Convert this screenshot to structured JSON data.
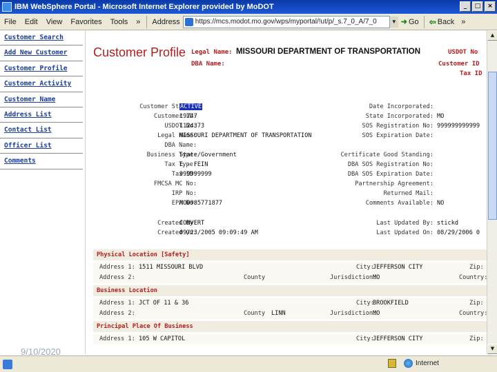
{
  "window": {
    "title": "IBM WebSphere Portal - Microsoft Internet Explorer provided by MoDOT",
    "min": "_",
    "max": "□",
    "close": "×"
  },
  "menubar": {
    "items": [
      "File",
      "Edit",
      "View",
      "Favorites",
      "Tools",
      "»"
    ],
    "address_label": "Address",
    "address_value": "https://mcs.modot.mo.gov/wps/myportal/!ut/p/_s.7_0_A/7_0",
    "go_label": "Go",
    "back_label": "Back",
    "more": "»"
  },
  "sidebar": {
    "items": [
      {
        "label": "Customer Search"
      },
      {
        "label": "Add New Customer"
      },
      {
        "label": "Customer Profile"
      },
      {
        "label": "Customer Activity"
      },
      {
        "label": "Customer Name"
      },
      {
        "label": "Address List"
      },
      {
        "label": "Contact List"
      },
      {
        "label": "Officer List"
      },
      {
        "label": "Comments"
      }
    ]
  },
  "header": {
    "title": "Customer Profile",
    "legal_name_label": "Legal Name:",
    "legal_name_value": "MISSOURI DEPARTMENT OF TRANSPORTATION",
    "dba_name_label": "DBA Name:",
    "usdot_label": "USDOT No",
    "customer_id_label": "Customer ID",
    "tax_id_label": "Tax ID"
  },
  "details": {
    "left": [
      {
        "label": "Customer Status:",
        "value": "ACTIVE"
      },
      {
        "label": "Customer ID:",
        "value": "19747"
      },
      {
        "label": "USDOT No:",
        "value": "1124373"
      },
      {
        "label": "Legal Name:",
        "value": "MISSOURI DEPARTMENT OF TRANSPORTATION"
      },
      {
        "label": "DBA Name:",
        "value": ""
      },
      {
        "label": "Business Type:",
        "value": "State/Government"
      },
      {
        "label": "Tax Type:",
        "value": "E - FEIN"
      },
      {
        "label": "Tax ID:",
        "value": "999999999"
      },
      {
        "label": "FMCSA MC No:",
        "value": ""
      },
      {
        "label": "IRP No:",
        "value": ""
      },
      {
        "label": "EPA No:",
        "value": "MOD985771877"
      }
    ],
    "right": [
      {
        "label": "Date Incorporated:",
        "value": ""
      },
      {
        "label": "State Incorporated:",
        "value": "MO"
      },
      {
        "label": "SOS Registration No:",
        "value": "999999999999"
      },
      {
        "label": "SOS Expiration Date:",
        "value": ""
      },
      {
        "label": "Certificate Good Standing:",
        "value": ""
      },
      {
        "label": "DBA SOS Registration No:",
        "value": ""
      },
      {
        "label": "DBA SOS Expiration Date:",
        "value": ""
      },
      {
        "label": "Partnership Agreement:",
        "value": ""
      },
      {
        "label": "Returned Mail:",
        "value": ""
      },
      {
        "label": "Comments Available:",
        "value": "NO"
      }
    ],
    "created_by_label": "Created By:",
    "created_by_value": "CONVERT",
    "created_on_label": "Created On:",
    "created_on_value": "09/23/2005 09:09:49 AM",
    "updated_by_label": "Last Updated By:",
    "updated_by_value": "stickd",
    "updated_on_label": "Last Updated On:",
    "updated_on_value": "08/29/2006 0"
  },
  "sections": [
    {
      "title": "Physical Location [Safety]",
      "address1": "1511 MISSOURI BLVD",
      "address2": "",
      "county": "",
      "city": "JEFFERSON CITY",
      "jurisdiction": "MO"
    },
    {
      "title": "Business Location",
      "address1": "JCT OF 11 & 36",
      "address2": "",
      "county": "LINN",
      "city": "BROOKFIELD",
      "jurisdiction": "MO"
    },
    {
      "title": "Principal Place Of Business",
      "address1": "105 W CAPITOL",
      "address2": "",
      "county": "",
      "city": "JEFFERSON CITY",
      "jurisdiction": ""
    }
  ],
  "section_labels": {
    "address1": "Address 1:",
    "address2": "Address 2:",
    "county": "County",
    "city": "City:",
    "jurisdiction": "Jurisdiction:",
    "zip": "Zip:",
    "country": "Country:"
  },
  "statusbar": {
    "date_overlay": "9/10/2020",
    "zone": "Internet"
  }
}
